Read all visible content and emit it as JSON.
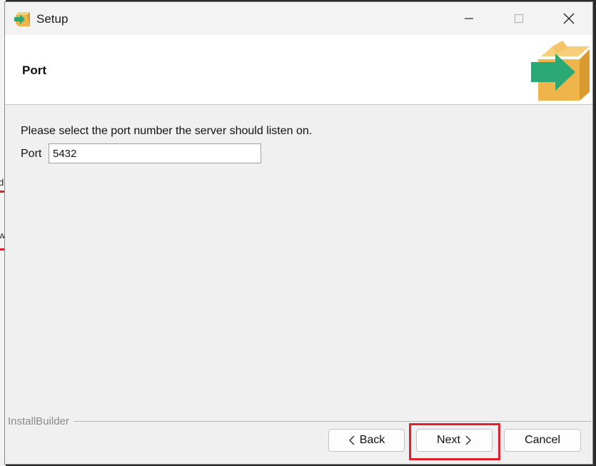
{
  "window": {
    "title": "Setup"
  },
  "header": {
    "title": "Port"
  },
  "content": {
    "prompt": "Please select the port number the server should listen on.",
    "port_label": "Port",
    "port_value": "5432"
  },
  "footer": {
    "brand": "InstallBuilder"
  },
  "buttons": {
    "back": "Back",
    "next": "Next",
    "cancel": "Cancel"
  },
  "background": {
    "glyph_1": "d",
    "glyph_2": "w"
  },
  "icons": {
    "app": "installer-box-arrow-icon",
    "minimize": "minimize-icon",
    "maximize": "maximize-icon",
    "close": "close-icon",
    "logo": "installer-box-arrow-icon",
    "back": "chevron-left-icon",
    "next": "chevron-right-icon"
  },
  "colors": {
    "box": "#f0b54a",
    "arrow": "#2aa876",
    "highlight": "#e0202a"
  }
}
